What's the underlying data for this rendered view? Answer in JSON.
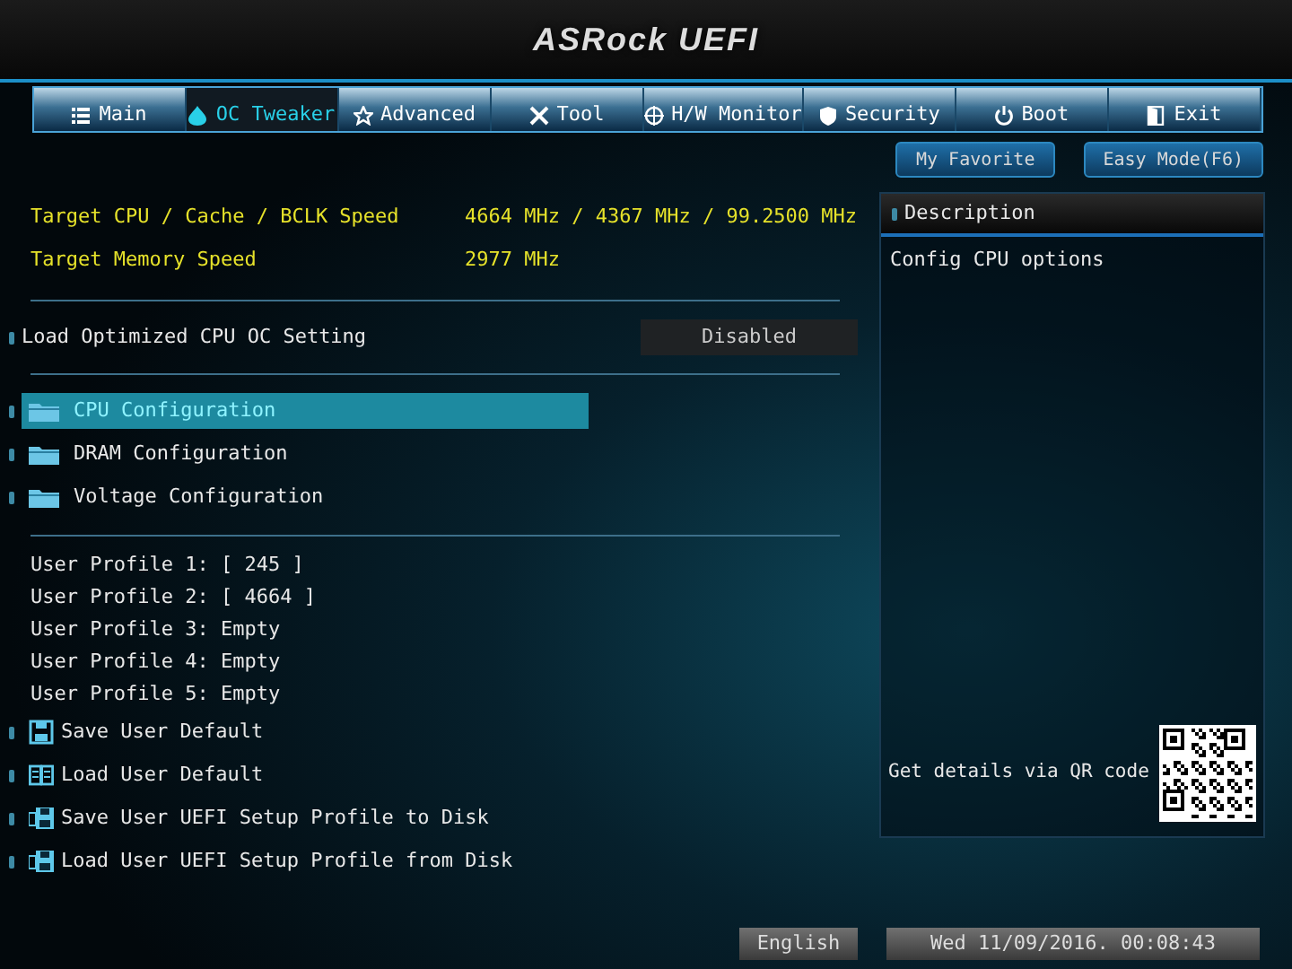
{
  "header": {
    "logo": "ASRock UEFI"
  },
  "tabs": [
    {
      "label": "Main",
      "kind": "list",
      "selected": false
    },
    {
      "label": "OC Tweaker",
      "kind": "flame",
      "selected": true
    },
    {
      "label": "Advanced",
      "kind": "star",
      "selected": false
    },
    {
      "label": "Tool",
      "kind": "tools",
      "selected": false
    },
    {
      "label": "H/W Monitor",
      "kind": "crosshair",
      "selected": false
    },
    {
      "label": "Security",
      "kind": "shield",
      "selected": false
    },
    {
      "label": "Boot",
      "kind": "power",
      "selected": false
    },
    {
      "label": "Exit",
      "kind": "door",
      "selected": false
    }
  ],
  "top_buttons": [
    "My Favorite",
    "Easy Mode(F6)"
  ],
  "targets": [
    {
      "label": "Target CPU / Cache / BCLK Speed",
      "value": "4664 MHz / 4367 MHz / 99.2500 MHz"
    },
    {
      "label": "Target Memory Speed",
      "value": "2977 MHz"
    }
  ],
  "option": {
    "label": "Load Optimized CPU OC Setting",
    "value": "Disabled"
  },
  "menu": [
    {
      "label": "CPU Configuration",
      "selected": true
    },
    {
      "label": "DRAM Configuration",
      "selected": false
    },
    {
      "label": "Voltage Configuration",
      "selected": false
    }
  ],
  "profiles": [
    "User Profile 1: [ 245 ]",
    "User Profile 2: [ 4664 ]",
    "User Profile 3: Empty",
    "User Profile 4: Empty",
    "User Profile 5: Empty"
  ],
  "actions": [
    {
      "label": "Save User Default",
      "kind": "floppy"
    },
    {
      "label": "Load User Default",
      "kind": "book"
    },
    {
      "label": "Save User UEFI Setup Profile to Disk",
      "kind": "disk"
    },
    {
      "label": "Load User UEFI Setup Profile from Disk",
      "kind": "disk"
    }
  ],
  "description": {
    "title": "Description",
    "text": "Config CPU options",
    "qr_hint": "Get details via QR code"
  },
  "status_bar": {
    "language": "English",
    "datetime": "Wed 11/09/2016. 00:08:43"
  }
}
